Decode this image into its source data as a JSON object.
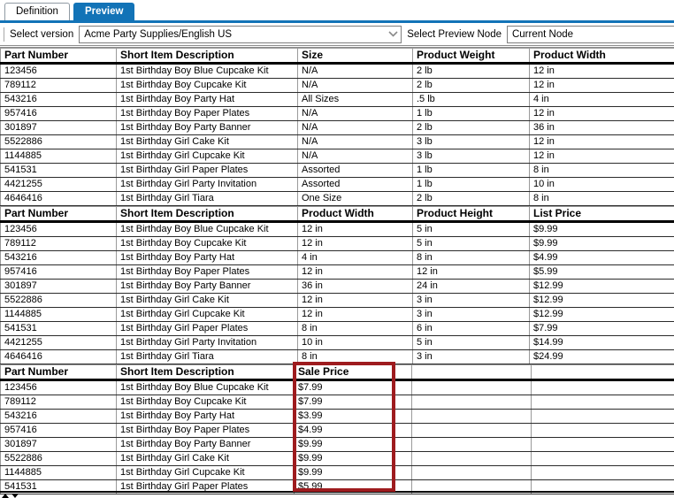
{
  "tabs": [
    {
      "label": "Definition",
      "active": false
    },
    {
      "label": "Preview",
      "active": true
    }
  ],
  "toolbar": {
    "version_label": "Select version",
    "version_value": "Acme Party Supplies/English US",
    "node_label": "Select Preview Node",
    "node_value": "Current Node"
  },
  "icons": {
    "version_dropdown": "chevron-down",
    "scroll_up": "triangle-up",
    "scroll_down": "triangle-down"
  },
  "colors": {
    "accent_blue": "#1273b7",
    "highlight_red": "#9e1b1e"
  },
  "tables": [
    {
      "headers": [
        "Part Number",
        "Short Item Description",
        "Size",
        "Product Weight",
        "Product Width"
      ],
      "rows": [
        [
          "123456",
          "1st Birthday Boy Blue Cupcake Kit",
          "N/A",
          "2 lb",
          "12 in"
        ],
        [
          "789112",
          "1st Birthday Boy Cupcake Kit",
          "N/A",
          "2 lb",
          "12 in"
        ],
        [
          "543216",
          "1st Birthday Boy Party Hat",
          "All Sizes",
          ".5 lb",
          "4 in"
        ],
        [
          "957416",
          "1st Birthday Boy Paper Plates",
          "N/A",
          "1 lb",
          "12 in"
        ],
        [
          "301897",
          "1st Birthday Boy Party Banner",
          "N/A",
          "2 lb",
          "36 in"
        ],
        [
          "5522886",
          "1st Birthday Girl Cake Kit",
          "N/A",
          "3 lb",
          "12 in"
        ],
        [
          "1144885",
          "1st Birthday Girl Cupcake Kit",
          "N/A",
          "3 lb",
          "12 in"
        ],
        [
          "541531",
          "1st Birthday Girl Paper Plates",
          "Assorted",
          "1 lb",
          "8 in"
        ],
        [
          "4421255",
          "1st Birthday Girl Party Invitation",
          "Assorted",
          "1 lb",
          "10 in"
        ],
        [
          "4646416",
          "1st Birthday Girl Tiara",
          "One Size",
          "2 lb",
          "8 in"
        ]
      ]
    },
    {
      "headers": [
        "Part Number",
        "Short Item Description",
        "Product Width",
        "Product Height",
        "List Price"
      ],
      "rows": [
        [
          "123456",
          "1st Birthday Boy Blue Cupcake Kit",
          "12 in",
          "5 in",
          "$9.99"
        ],
        [
          "789112",
          "1st Birthday Boy Cupcake Kit",
          "12 in",
          "5 in",
          "$9.99"
        ],
        [
          "543216",
          "1st Birthday Boy Party Hat",
          "4 in",
          "8 in",
          "$4.99"
        ],
        [
          "957416",
          "1st Birthday Boy Paper Plates",
          "12 in",
          "12 in",
          "$5.99"
        ],
        [
          "301897",
          "1st Birthday Boy Party Banner",
          "36 in",
          "24 in",
          "$12.99"
        ],
        [
          "5522886",
          "1st Birthday Girl Cake Kit",
          "12 in",
          "3 in",
          "$12.99"
        ],
        [
          "1144885",
          "1st Birthday Girl Cupcake Kit",
          "12 in",
          "3 in",
          "$12.99"
        ],
        [
          "541531",
          "1st Birthday Girl Paper Plates",
          "8 in",
          "6 in",
          "$7.99"
        ],
        [
          "4421255",
          "1st Birthday Girl Party Invitation",
          "10 in",
          "5 in",
          "$14.99"
        ],
        [
          "4646416",
          "1st Birthday Girl Tiara",
          "8 in",
          "3 in",
          "$24.99"
        ]
      ]
    },
    {
      "headers": [
        "Part Number",
        "Short Item Description",
        "Sale Price",
        "",
        ""
      ],
      "rows": [
        [
          "123456",
          "1st Birthday Boy Blue Cupcake Kit",
          "$7.99",
          "",
          ""
        ],
        [
          "789112",
          "1st Birthday Boy Cupcake Kit",
          "$7.99",
          "",
          ""
        ],
        [
          "543216",
          "1st Birthday Boy Party Hat",
          "$3.99",
          "",
          ""
        ],
        [
          "957416",
          "1st Birthday Boy Paper Plates",
          "$4.99",
          "",
          ""
        ],
        [
          "301897",
          "1st Birthday Boy Party Banner",
          "$9.99",
          "",
          ""
        ],
        [
          "5522886",
          "1st Birthday Girl Cake Kit",
          "$9.99",
          "",
          ""
        ],
        [
          "1144885",
          "1st Birthday Girl Cupcake Kit",
          "$9.99",
          "",
          ""
        ],
        [
          "541531",
          "1st Birthday Girl Paper Plates",
          "$5.99",
          "",
          ""
        ]
      ]
    }
  ]
}
